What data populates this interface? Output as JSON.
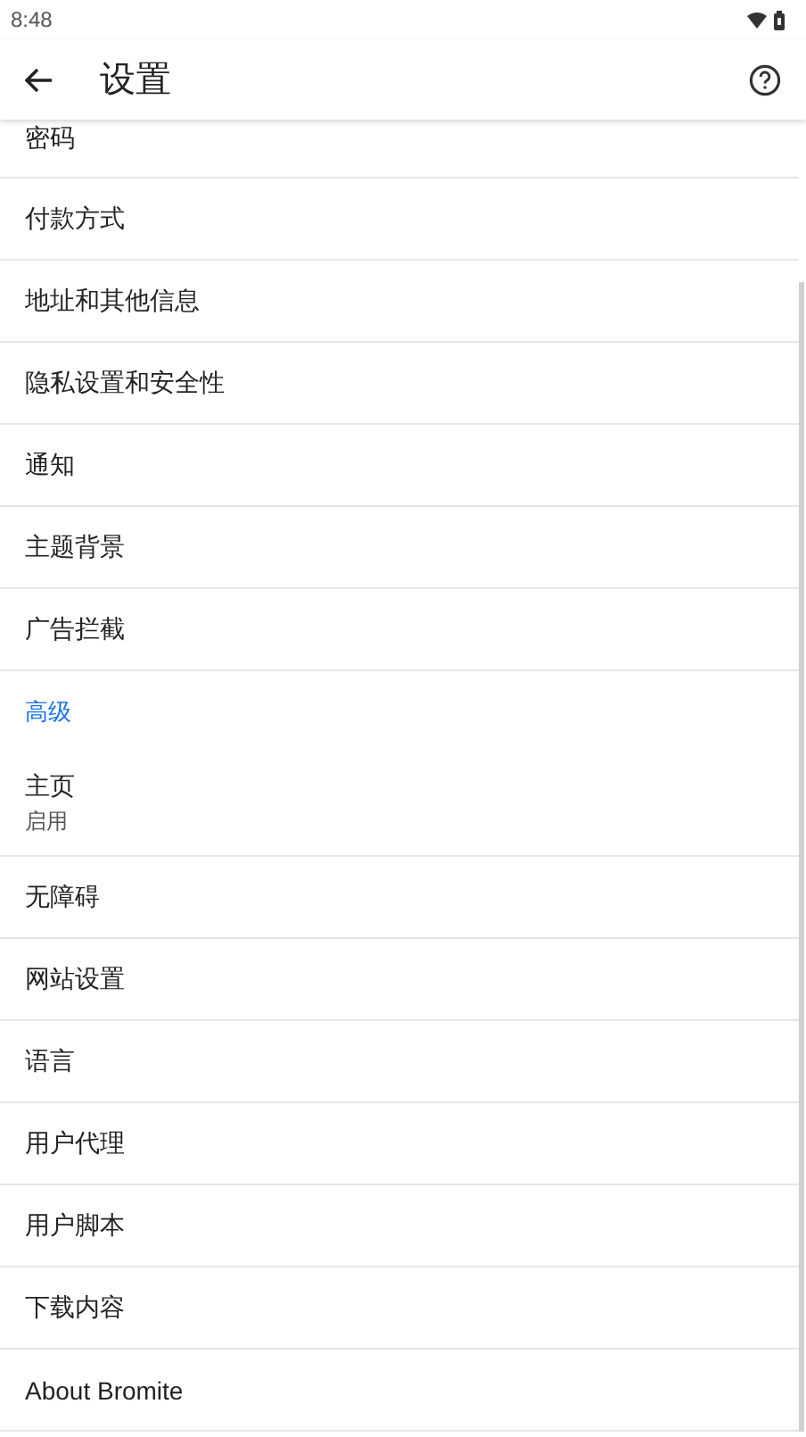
{
  "status_bar": {
    "time": "8:48"
  },
  "toolbar": {
    "title": "设置"
  },
  "items": [
    {
      "kind": "item",
      "label": "密码"
    },
    {
      "kind": "item",
      "label": "付款方式"
    },
    {
      "kind": "item",
      "label": "地址和其他信息"
    },
    {
      "kind": "item",
      "label": "隐私设置和安全性"
    },
    {
      "kind": "item",
      "label": "通知"
    },
    {
      "kind": "item",
      "label": "主题背景"
    },
    {
      "kind": "item",
      "label": "广告拦截"
    },
    {
      "kind": "header",
      "label": "高级"
    },
    {
      "kind": "item",
      "label": "主页",
      "summary": "启用"
    },
    {
      "kind": "item",
      "label": "无障碍"
    },
    {
      "kind": "item",
      "label": "网站设置"
    },
    {
      "kind": "item",
      "label": "语言"
    },
    {
      "kind": "item",
      "label": "用户代理"
    },
    {
      "kind": "item",
      "label": "用户脚本"
    },
    {
      "kind": "item",
      "label": "下载内容"
    },
    {
      "kind": "item",
      "label": "About Bromite"
    }
  ]
}
